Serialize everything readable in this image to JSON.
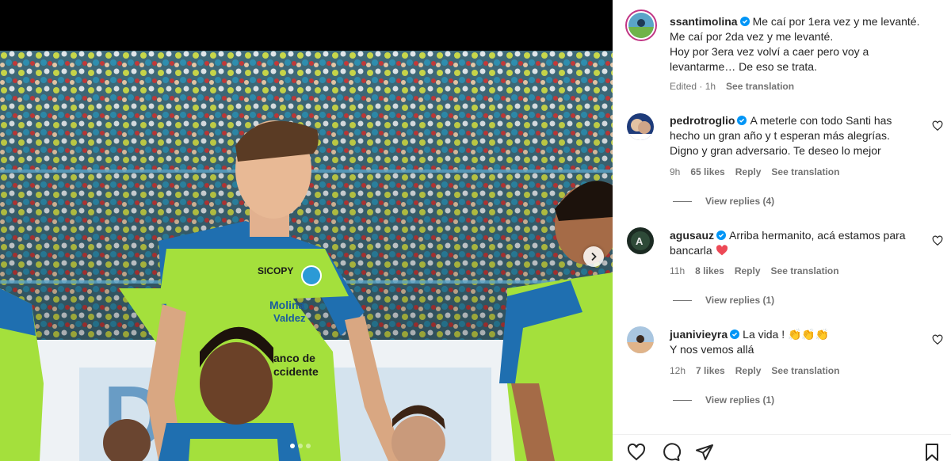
{
  "post": {
    "author": "ssantimolina",
    "caption_lines": [
      "Me caí por 1era vez y me levanté.",
      "Me caí por 2da vez y me levanté.",
      "Hoy por 3era vez volví a caer pero voy a",
      "levantarme… De eso se trata."
    ],
    "edited_time": "Edited · 1h",
    "see_translation": "See translation"
  },
  "comments": [
    {
      "username": "pedrotroglio",
      "text_lines": [
        "A meterle con todo Santi has",
        "hecho un gran año y t esperan más alegrías.",
        "Digno y gran adversario. Te deseo lo mejor"
      ],
      "time": "9h",
      "likes": "65 likes",
      "reply": "Reply",
      "see_translation": "See translation",
      "view_replies": "View replies (4)"
    },
    {
      "username": "agusauz",
      "text_lines": [
        "Arriba hermanito, acá estamos para",
        "bancarla"
      ],
      "time": "11h",
      "likes": "8 likes",
      "reply": "Reply",
      "see_translation": "See translation",
      "view_replies": "View replies (1)"
    },
    {
      "username": "juanivieyra",
      "text_lines": [
        "La vida ! 👏👏👏",
        "Y nos vemos allá"
      ],
      "time": "12h",
      "likes": "7 likes",
      "reply": "Reply",
      "see_translation": "See translation",
      "view_replies": "View replies (1)"
    }
  ],
  "colors": {
    "verified": "#0095f6",
    "heart_red": "#ed4956",
    "meta_gray": "#737373"
  },
  "media": {
    "jersey_sponsor_1": "SICOPY",
    "jersey_sponsor_2": "Molina Valdez",
    "jersey_sponsor_3": "Banco de Occidente",
    "carousel_slides": 3,
    "carousel_active": 1
  },
  "icons": {
    "next": "chevron-right-icon",
    "like": "heart-icon",
    "comment": "comment-icon",
    "share": "share-icon",
    "save": "bookmark-icon"
  }
}
